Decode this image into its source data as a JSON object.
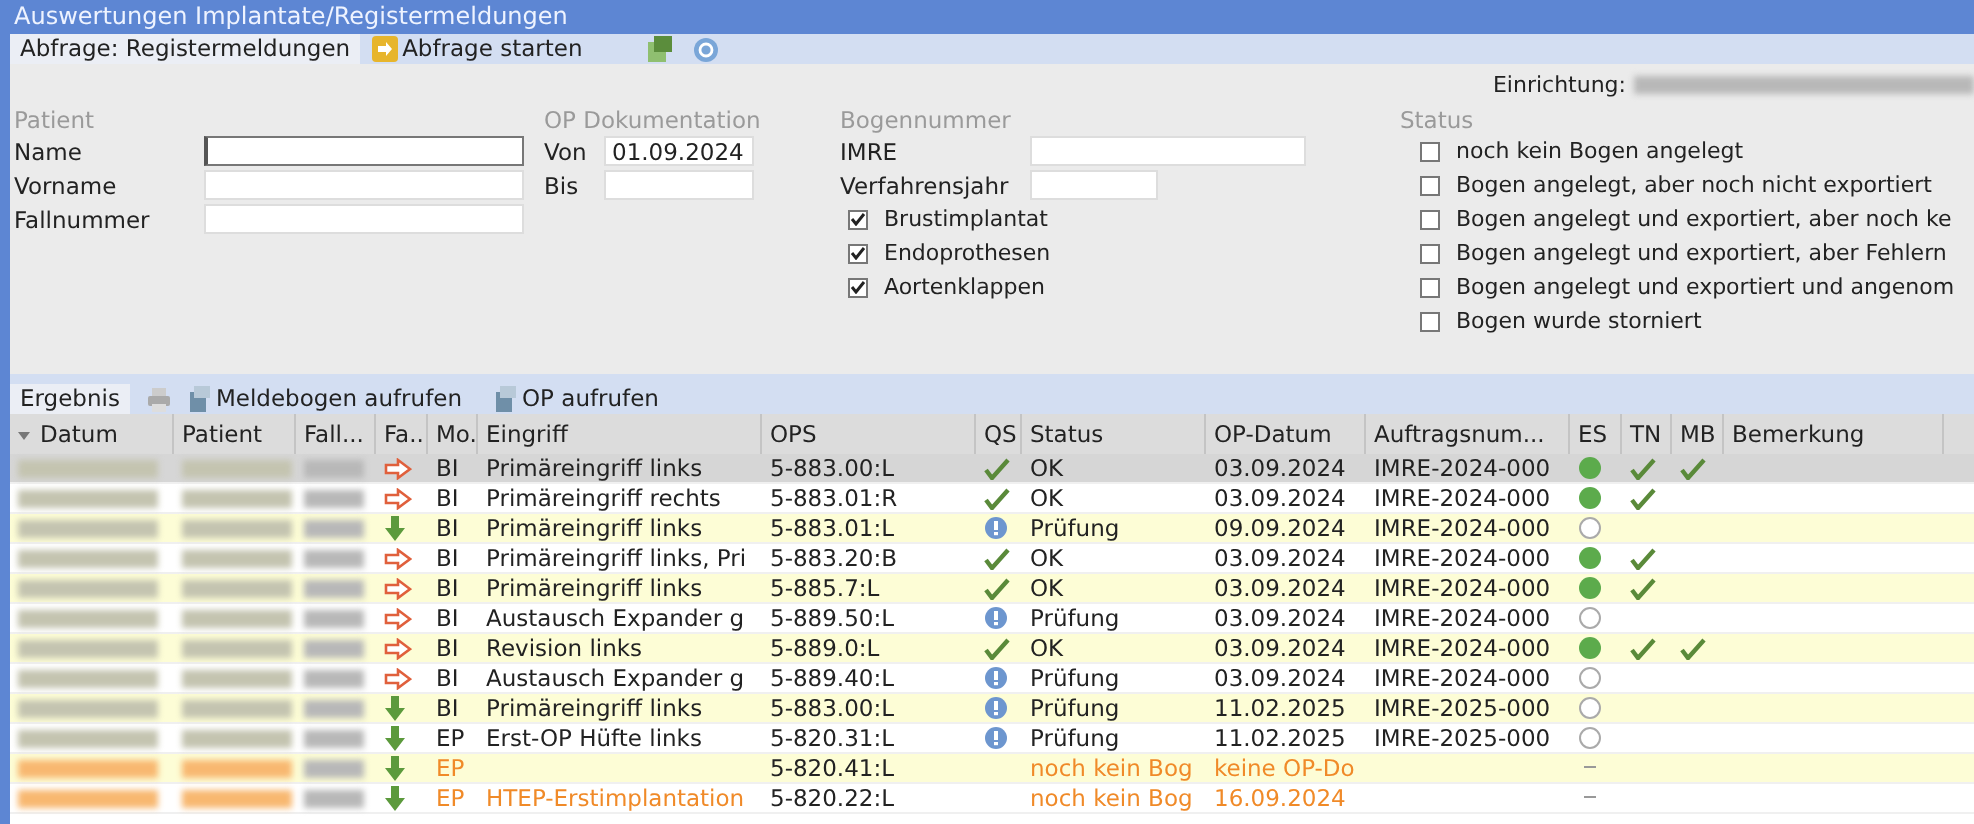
{
  "window": {
    "title": "Auswertungen Implantate/Registermeldungen"
  },
  "tabs": [
    {
      "label": "Abfrage: Registermeldungen",
      "selected": true
    }
  ],
  "start_button": {
    "label": "Abfrage starten"
  },
  "einrichtung_label": "Einrichtung:",
  "patient": {
    "heading": "Patient",
    "fields": [
      {
        "label": "Name",
        "focused": true
      },
      {
        "label": "Vorname",
        "focused": false
      },
      {
        "label": "Fallnummer",
        "focused": false
      }
    ]
  },
  "op_doku": {
    "heading": "OP Dokumentation",
    "fields": [
      {
        "label": "Von",
        "value": "01.09.2024"
      },
      {
        "label": "Bis"
      }
    ]
  },
  "bogen": {
    "heading": "Bogennummer",
    "fields": [
      {
        "label": "IMRE"
      },
      {
        "label": "Verfahrensjahr"
      }
    ],
    "checks": [
      {
        "label": "Brustimplantat",
        "checked": true
      },
      {
        "label": "Endoprothesen",
        "checked": true
      },
      {
        "label": "Aortenklappen",
        "checked": true
      }
    ]
  },
  "status": {
    "heading": "Status",
    "checks": [
      {
        "label": "noch kein Bogen angelegt",
        "checked": false
      },
      {
        "label": "Bogen angelegt, aber noch nicht exportiert",
        "checked": false
      },
      {
        "label": "Bogen angelegt und exportiert, aber noch ke",
        "checked": false
      },
      {
        "label": "Bogen angelegt und exportiert, aber Fehlern",
        "checked": false
      },
      {
        "label": "Bogen angelegt und exportiert und angenom",
        "checked": false
      },
      {
        "label": "Bogen wurde storniert",
        "checked": false
      }
    ]
  },
  "result_tabs": [
    {
      "label": "Ergebnis",
      "selected": true
    }
  ],
  "result_actions": [
    {
      "label": "Meldebogen aufrufen"
    },
    {
      "label": "OP aufrufen"
    }
  ],
  "table": {
    "columns": [
      "Datum",
      "Patient",
      "Fall...",
      "Fa..",
      "Mo.",
      "Eingriff",
      "OPS",
      "QS",
      "Status",
      "OP-Datum",
      "Auftragsnum...",
      "ES",
      "TN",
      "MB",
      "Bemerkung"
    ],
    "rows": [
      {
        "selected": true,
        "pending": false,
        "fa_down": false,
        "mo": "BI",
        "eingriff": "Primäreingriff links",
        "ops": "5-883.00:L",
        "qs_ok": true,
        "qs_info": false,
        "status": "OK",
        "op_datum": "03.09.2024",
        "auftrag": "IMRE-2024-000",
        "es_done": true,
        "es_none": false,
        "tn": true,
        "mb": true
      },
      {
        "selected": false,
        "pending": false,
        "fa_down": false,
        "mo": "BI",
        "eingriff": "Primäreingriff rechts",
        "ops": "5-883.01:R",
        "qs_ok": true,
        "qs_info": false,
        "status": "OK",
        "op_datum": "03.09.2024",
        "auftrag": "IMRE-2024-000",
        "es_done": true,
        "es_none": false,
        "tn": true,
        "mb": false
      },
      {
        "selected": false,
        "pending": false,
        "fa_down": true,
        "mo": "BI",
        "eingriff": "Primäreingriff links",
        "ops": "5-883.01:L",
        "qs_ok": false,
        "qs_info": true,
        "status": "Prüfung",
        "op_datum": "09.09.2024",
        "auftrag": "IMRE-2024-000",
        "es_done": false,
        "es_none": false,
        "tn": false,
        "mb": false
      },
      {
        "selected": false,
        "pending": false,
        "fa_down": false,
        "mo": "BI",
        "eingriff": "Primäreingriff links, Pri",
        "ops": "5-883.20:B",
        "qs_ok": true,
        "qs_info": false,
        "status": "OK",
        "op_datum": "03.09.2024",
        "auftrag": "IMRE-2024-000",
        "es_done": true,
        "es_none": false,
        "tn": true,
        "mb": false
      },
      {
        "selected": false,
        "pending": false,
        "fa_down": false,
        "mo": "BI",
        "eingriff": "Primäreingriff links",
        "ops": "5-885.7:L",
        "qs_ok": true,
        "qs_info": false,
        "status": "OK",
        "op_datum": "03.09.2024",
        "auftrag": "IMRE-2024-000",
        "es_done": true,
        "es_none": false,
        "tn": true,
        "mb": false
      },
      {
        "selected": false,
        "pending": false,
        "fa_down": false,
        "mo": "BI",
        "eingriff": "Austausch Expander g",
        "ops": "5-889.50:L",
        "qs_ok": false,
        "qs_info": true,
        "status": "Prüfung",
        "op_datum": "03.09.2024",
        "auftrag": "IMRE-2024-000",
        "es_done": false,
        "es_none": false,
        "tn": false,
        "mb": false
      },
      {
        "selected": false,
        "pending": false,
        "fa_down": false,
        "mo": "BI",
        "eingriff": "Revision links",
        "ops": "5-889.0:L",
        "qs_ok": true,
        "qs_info": false,
        "status": "OK",
        "op_datum": "03.09.2024",
        "auftrag": "IMRE-2024-000",
        "es_done": true,
        "es_none": false,
        "tn": true,
        "mb": true
      },
      {
        "selected": false,
        "pending": false,
        "fa_down": false,
        "mo": "BI",
        "eingriff": "Austausch Expander g",
        "ops": "5-889.40:L",
        "qs_ok": false,
        "qs_info": true,
        "status": "Prüfung",
        "op_datum": "03.09.2024",
        "auftrag": "IMRE-2024-000",
        "es_done": false,
        "es_none": false,
        "tn": false,
        "mb": false
      },
      {
        "selected": false,
        "pending": false,
        "fa_down": true,
        "mo": "BI",
        "eingriff": "Primäreingriff links",
        "ops": "5-883.00:L",
        "qs_ok": false,
        "qs_info": true,
        "status": "Prüfung",
        "op_datum": "11.02.2025",
        "auftrag": "IMRE-2025-000",
        "es_done": false,
        "es_none": false,
        "tn": false,
        "mb": false
      },
      {
        "selected": false,
        "pending": false,
        "fa_down": true,
        "mo": "EP",
        "eingriff": "Erst-OP Hüfte links",
        "ops": "5-820.31:L",
        "qs_ok": false,
        "qs_info": true,
        "status": "Prüfung",
        "op_datum": "11.02.2025",
        "auftrag": "IMRE-2025-000",
        "es_done": false,
        "es_none": false,
        "tn": false,
        "mb": false
      },
      {
        "selected": false,
        "pending": true,
        "fa_down": true,
        "mo": "EP",
        "ops": "5-820.41:L",
        "qs_ok": false,
        "qs_info": false,
        "status": "noch kein Bog",
        "op_datum": "keine OP-Do",
        "es_none": true,
        "tn": false,
        "mb": false
      },
      {
        "selected": false,
        "pending": true,
        "fa_down": true,
        "mo": "EP",
        "eingriff": "HTEP-Erstimplantation",
        "ops": "5-820.22:L",
        "qs_ok": false,
        "qs_info": false,
        "status": "noch kein Bog",
        "op_datum": "16.09.2024",
        "es_none": true,
        "tn": false,
        "mb": false
      }
    ]
  }
}
